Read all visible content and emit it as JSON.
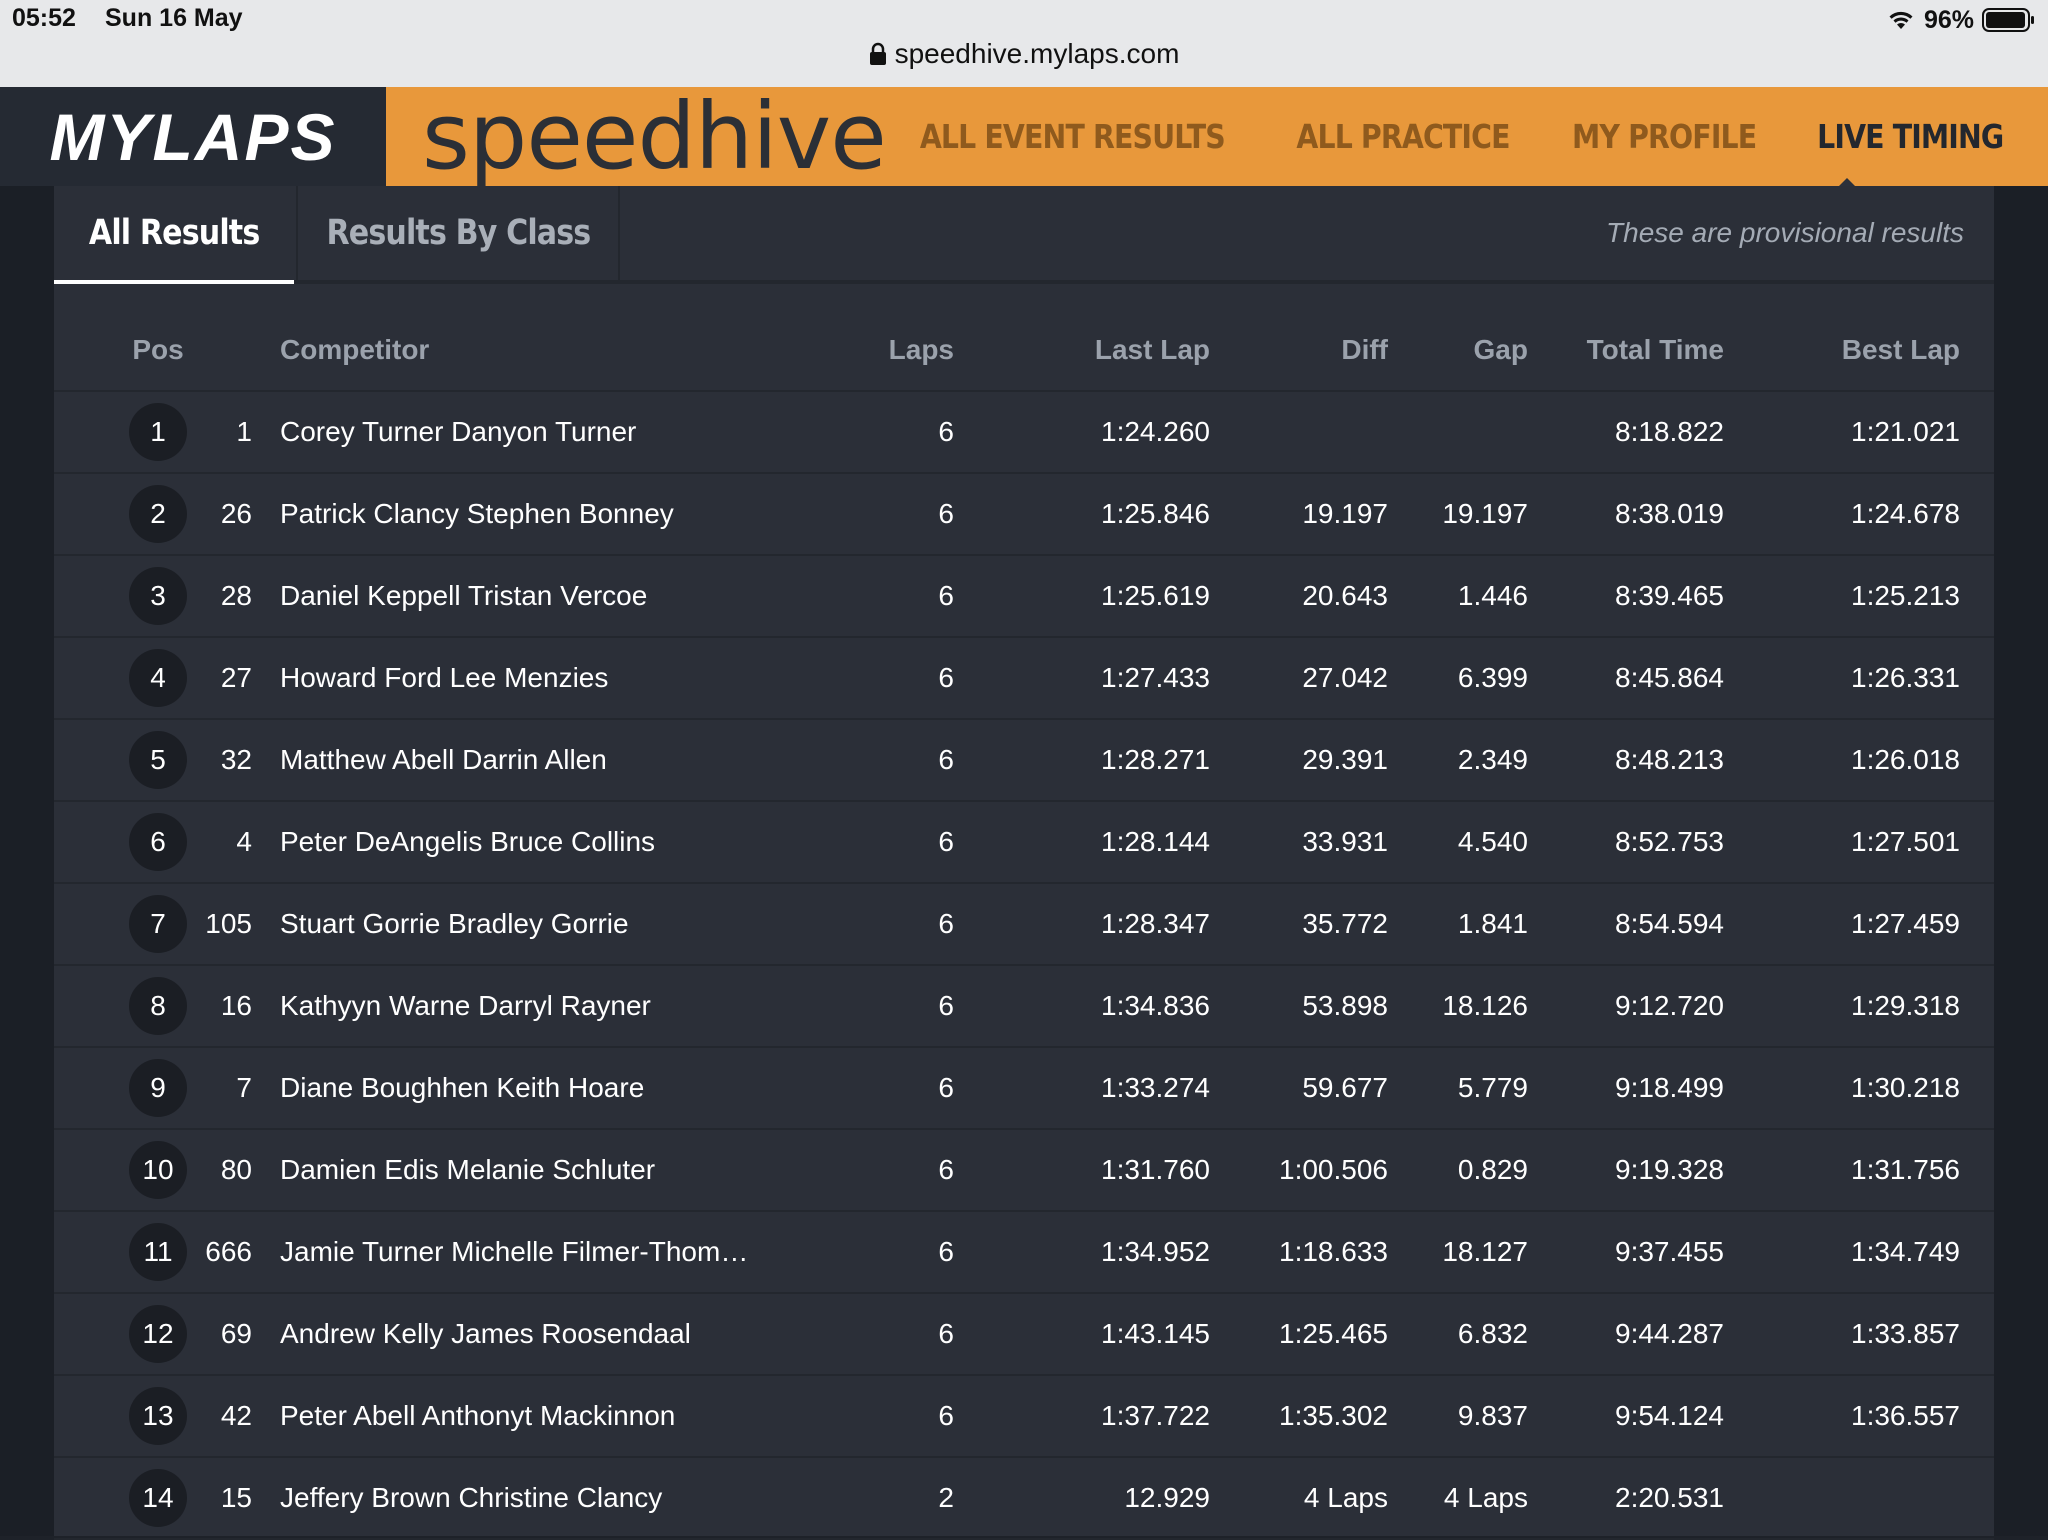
{
  "status_bar": {
    "time": "05:52",
    "date": "Sun 16 May",
    "battery": "96%"
  },
  "browser": {
    "url": "speedhive.mylaps.com"
  },
  "brand": {
    "mylaps": "MYLAPS",
    "speedhive": "speedhive"
  },
  "nav": {
    "items": [
      {
        "label": "ALL EVENT RESULTS",
        "active": false
      },
      {
        "label": "ALL PRACTICE",
        "active": false
      },
      {
        "label": "MY PROFILE",
        "active": false
      },
      {
        "label": "LIVE TIMING",
        "active": true
      }
    ]
  },
  "tabs": [
    {
      "label": "All Results",
      "active": true
    },
    {
      "label": "Results By Class",
      "active": false
    }
  ],
  "provisional_note": "These are provisional results",
  "table": {
    "headers": {
      "pos": "Pos",
      "competitor": "Competitor",
      "laps": "Laps",
      "last_lap": "Last Lap",
      "diff": "Diff",
      "gap": "Gap",
      "total_time": "Total Time",
      "best_lap": "Best Lap"
    },
    "rows": [
      {
        "pos": "1",
        "num": "1",
        "competitor": "Corey Turner Danyon Turner",
        "laps": "6",
        "last_lap": "1:24.260",
        "diff": "",
        "gap": "",
        "total_time": "8:18.822",
        "best_lap": "1:21.021"
      },
      {
        "pos": "2",
        "num": "26",
        "competitor": "Patrick Clancy Stephen Bonney",
        "laps": "6",
        "last_lap": "1:25.846",
        "diff": "19.197",
        "gap": "19.197",
        "total_time": "8:38.019",
        "best_lap": "1:24.678"
      },
      {
        "pos": "3",
        "num": "28",
        "competitor": "Daniel Keppell Tristan Vercoe",
        "laps": "6",
        "last_lap": "1:25.619",
        "diff": "20.643",
        "gap": "1.446",
        "total_time": "8:39.465",
        "best_lap": "1:25.213"
      },
      {
        "pos": "4",
        "num": "27",
        "competitor": "Howard Ford Lee Menzies",
        "laps": "6",
        "last_lap": "1:27.433",
        "diff": "27.042",
        "gap": "6.399",
        "total_time": "8:45.864",
        "best_lap": "1:26.331"
      },
      {
        "pos": "5",
        "num": "32",
        "competitor": "Matthew Abell Darrin Allen",
        "laps": "6",
        "last_lap": "1:28.271",
        "diff": "29.391",
        "gap": "2.349",
        "total_time": "8:48.213",
        "best_lap": "1:26.018"
      },
      {
        "pos": "6",
        "num": "4",
        "competitor": "Peter DeAngelis Bruce Collins",
        "laps": "6",
        "last_lap": "1:28.144",
        "diff": "33.931",
        "gap": "4.540",
        "total_time": "8:52.753",
        "best_lap": "1:27.501"
      },
      {
        "pos": "7",
        "num": "105",
        "competitor": "Stuart Gorrie Bradley Gorrie",
        "laps": "6",
        "last_lap": "1:28.347",
        "diff": "35.772",
        "gap": "1.841",
        "total_time": "8:54.594",
        "best_lap": "1:27.459"
      },
      {
        "pos": "8",
        "num": "16",
        "competitor": "Kathyyn Warne Darryl Rayner",
        "laps": "6",
        "last_lap": "1:34.836",
        "diff": "53.898",
        "gap": "18.126",
        "total_time": "9:12.720",
        "best_lap": "1:29.318"
      },
      {
        "pos": "9",
        "num": "7",
        "competitor": "Diane Boughhen Keith Hoare",
        "laps": "6",
        "last_lap": "1:33.274",
        "diff": "59.677",
        "gap": "5.779",
        "total_time": "9:18.499",
        "best_lap": "1:30.218"
      },
      {
        "pos": "10",
        "num": "80",
        "competitor": "Damien Edis Melanie Schluter",
        "laps": "6",
        "last_lap": "1:31.760",
        "diff": "1:00.506",
        "gap": "0.829",
        "total_time": "9:19.328",
        "best_lap": "1:31.756"
      },
      {
        "pos": "11",
        "num": "666",
        "competitor": "Jamie Turner Michelle Filmer-Thom…",
        "laps": "6",
        "last_lap": "1:34.952",
        "diff": "1:18.633",
        "gap": "18.127",
        "total_time": "9:37.455",
        "best_lap": "1:34.749"
      },
      {
        "pos": "12",
        "num": "69",
        "competitor": "Andrew Kelly James Roosendaal",
        "laps": "6",
        "last_lap": "1:43.145",
        "diff": "1:25.465",
        "gap": "6.832",
        "total_time": "9:44.287",
        "best_lap": "1:33.857"
      },
      {
        "pos": "13",
        "num": "42",
        "competitor": "Peter Abell Anthonyt Mackinnon",
        "laps": "6",
        "last_lap": "1:37.722",
        "diff": "1:35.302",
        "gap": "9.837",
        "total_time": "9:54.124",
        "best_lap": "1:36.557"
      },
      {
        "pos": "14",
        "num": "15",
        "competitor": "Jeffery Brown Christine Clancy",
        "laps": "2",
        "last_lap": "12.929",
        "diff": "4 Laps",
        "gap": "4 Laps",
        "total_time": "2:20.531",
        "best_lap": ""
      }
    ]
  }
}
